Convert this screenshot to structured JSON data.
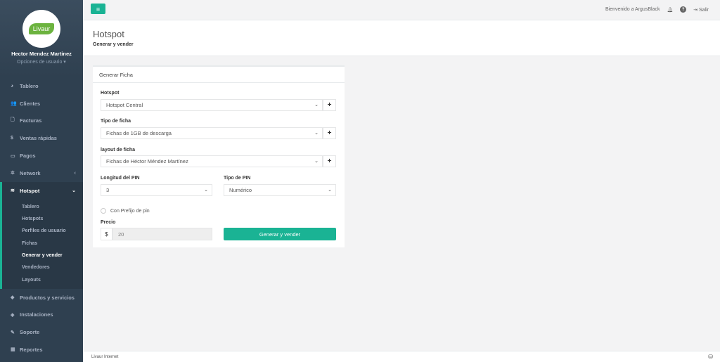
{
  "profile": {
    "logo": "Livaur",
    "name": "Hector Mendez Martinez",
    "options": "Opciones de usuario ▾"
  },
  "nav": [
    {
      "icon": "◕",
      "label": "Tablero"
    },
    {
      "icon": "👥",
      "label": "Clientes"
    },
    {
      "icon": "🗋",
      "label": "Facturas"
    },
    {
      "icon": "$",
      "label": "Ventas rápidas"
    },
    {
      "icon": "▭",
      "label": "Pagos"
    },
    {
      "icon": "✲",
      "label": "Network",
      "arrow": "‹"
    },
    {
      "icon": "≋",
      "label": "Hotspot",
      "arrow": "⌄"
    }
  ],
  "hotspot_sub": [
    "Tablero",
    "Hotspots",
    "Perfiles de usuario",
    "Fichas",
    "Generar y vender",
    "Vendedores",
    "Layouts"
  ],
  "nav_bottom": [
    {
      "icon": "◆",
      "label": "Productos y servicios"
    },
    {
      "icon": "◈",
      "label": "Instalaciones"
    },
    {
      "icon": "✎",
      "label": "Soporte"
    },
    {
      "icon": "▦",
      "label": "Reportes"
    }
  ],
  "topbar": {
    "menu_icon": "≡",
    "welcome": "Bienvenido a ArgusBlack",
    "bell": "🔔",
    "help": "?",
    "logout_icon": "⇥",
    "logout": "Salir"
  },
  "heading": {
    "title": "Hotspot",
    "crumb": "Generar y vender"
  },
  "card": {
    "title": "Generar Ficha",
    "hotspot_label": "Hotspot",
    "hotspot_value": "Hotspot Central",
    "tipo_label": "Tipo de ficha",
    "tipo_value": "Fichas de 1GB de descarga",
    "layout_label": "layout de ficha",
    "layout_value": "Fichas de Héctor Méndez Martínez",
    "pin_len_label": "Longitud del PIN",
    "pin_len_value": "3",
    "pin_type_label": "Tipo de PIN",
    "pin_type_value": "Numérico",
    "prefix_label": "Con Prefijo de pin",
    "price_label": "Precio",
    "currency": "$",
    "price_placeholder": "20",
    "submit": "Generar y vender",
    "plus": "+",
    "chevron": "⌄"
  },
  "footer": {
    "text": "Livaur Internet",
    "icon": "⛁"
  },
  "colors": {
    "sidebar": "#2f4050",
    "accent": "#1ab394"
  }
}
